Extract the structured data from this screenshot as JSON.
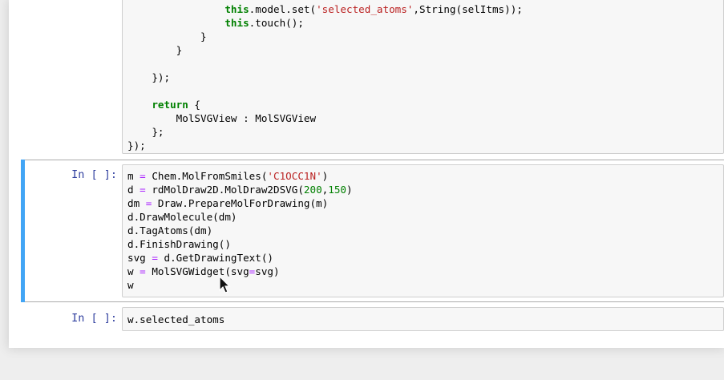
{
  "cell_js": {
    "lines": [
      [
        [
          "sp",
          "                "
        ],
        [
          "kw",
          "this"
        ],
        [
          "t",
          ".model.set("
        ],
        [
          "str",
          "'selected_atoms'"
        ],
        [
          "t",
          ",String(selItms));"
        ]
      ],
      [
        [
          "sp",
          "                "
        ],
        [
          "kw",
          "this"
        ],
        [
          "t",
          ".touch();"
        ]
      ],
      [
        [
          "sp",
          "            "
        ],
        [
          "t",
          "}"
        ]
      ],
      [
        [
          "sp",
          "        "
        ],
        [
          "t",
          "}"
        ]
      ],
      [
        [
          "t",
          ""
        ]
      ],
      [
        [
          "sp",
          "    "
        ],
        [
          "t",
          "});"
        ]
      ],
      [
        [
          "t",
          ""
        ]
      ],
      [
        [
          "sp",
          "    "
        ],
        [
          "kw",
          "return"
        ],
        [
          "t",
          " {"
        ]
      ],
      [
        [
          "sp",
          "        "
        ],
        [
          "t",
          "MolSVGView : MolSVGView"
        ]
      ],
      [
        [
          "sp",
          "    "
        ],
        [
          "t",
          "};"
        ]
      ],
      [
        [
          "t",
          "});"
        ]
      ]
    ]
  },
  "cell_draw": {
    "prompt": "In [ ]:",
    "lines": [
      [
        [
          "t",
          "m "
        ],
        [
          "op",
          "="
        ],
        [
          "t",
          " Chem.MolFromSmiles("
        ],
        [
          "str",
          "'C1OCC1N'"
        ],
        [
          "t",
          ")"
        ]
      ],
      [
        [
          "t",
          "d "
        ],
        [
          "op",
          "="
        ],
        [
          "t",
          " rdMolDraw2D.MolDraw2DSVG("
        ],
        [
          "num",
          "200"
        ],
        [
          "t",
          ","
        ],
        [
          "num",
          "150"
        ],
        [
          "t",
          ")"
        ]
      ],
      [
        [
          "t",
          "dm "
        ],
        [
          "op",
          "="
        ],
        [
          "t",
          " Draw.PrepareMolForDrawing(m)"
        ]
      ],
      [
        [
          "t",
          "d.DrawMolecule(dm)"
        ]
      ],
      [
        [
          "t",
          "d.TagAtoms(dm)"
        ]
      ],
      [
        [
          "t",
          "d.FinishDrawing()"
        ]
      ],
      [
        [
          "t",
          "svg "
        ],
        [
          "op",
          "="
        ],
        [
          "t",
          " d.GetDrawingText()"
        ]
      ],
      [
        [
          "t",
          "w "
        ],
        [
          "op",
          "="
        ],
        [
          "t",
          " MolSVGWidget(svg"
        ],
        [
          "op",
          "="
        ],
        [
          "t",
          "svg)"
        ]
      ],
      [
        [
          "t",
          "w"
        ]
      ]
    ]
  },
  "cell_selected": {
    "prompt": "In [ ]:",
    "lines": [
      [
        [
          "t",
          "w.selected_atoms"
        ]
      ]
    ]
  }
}
